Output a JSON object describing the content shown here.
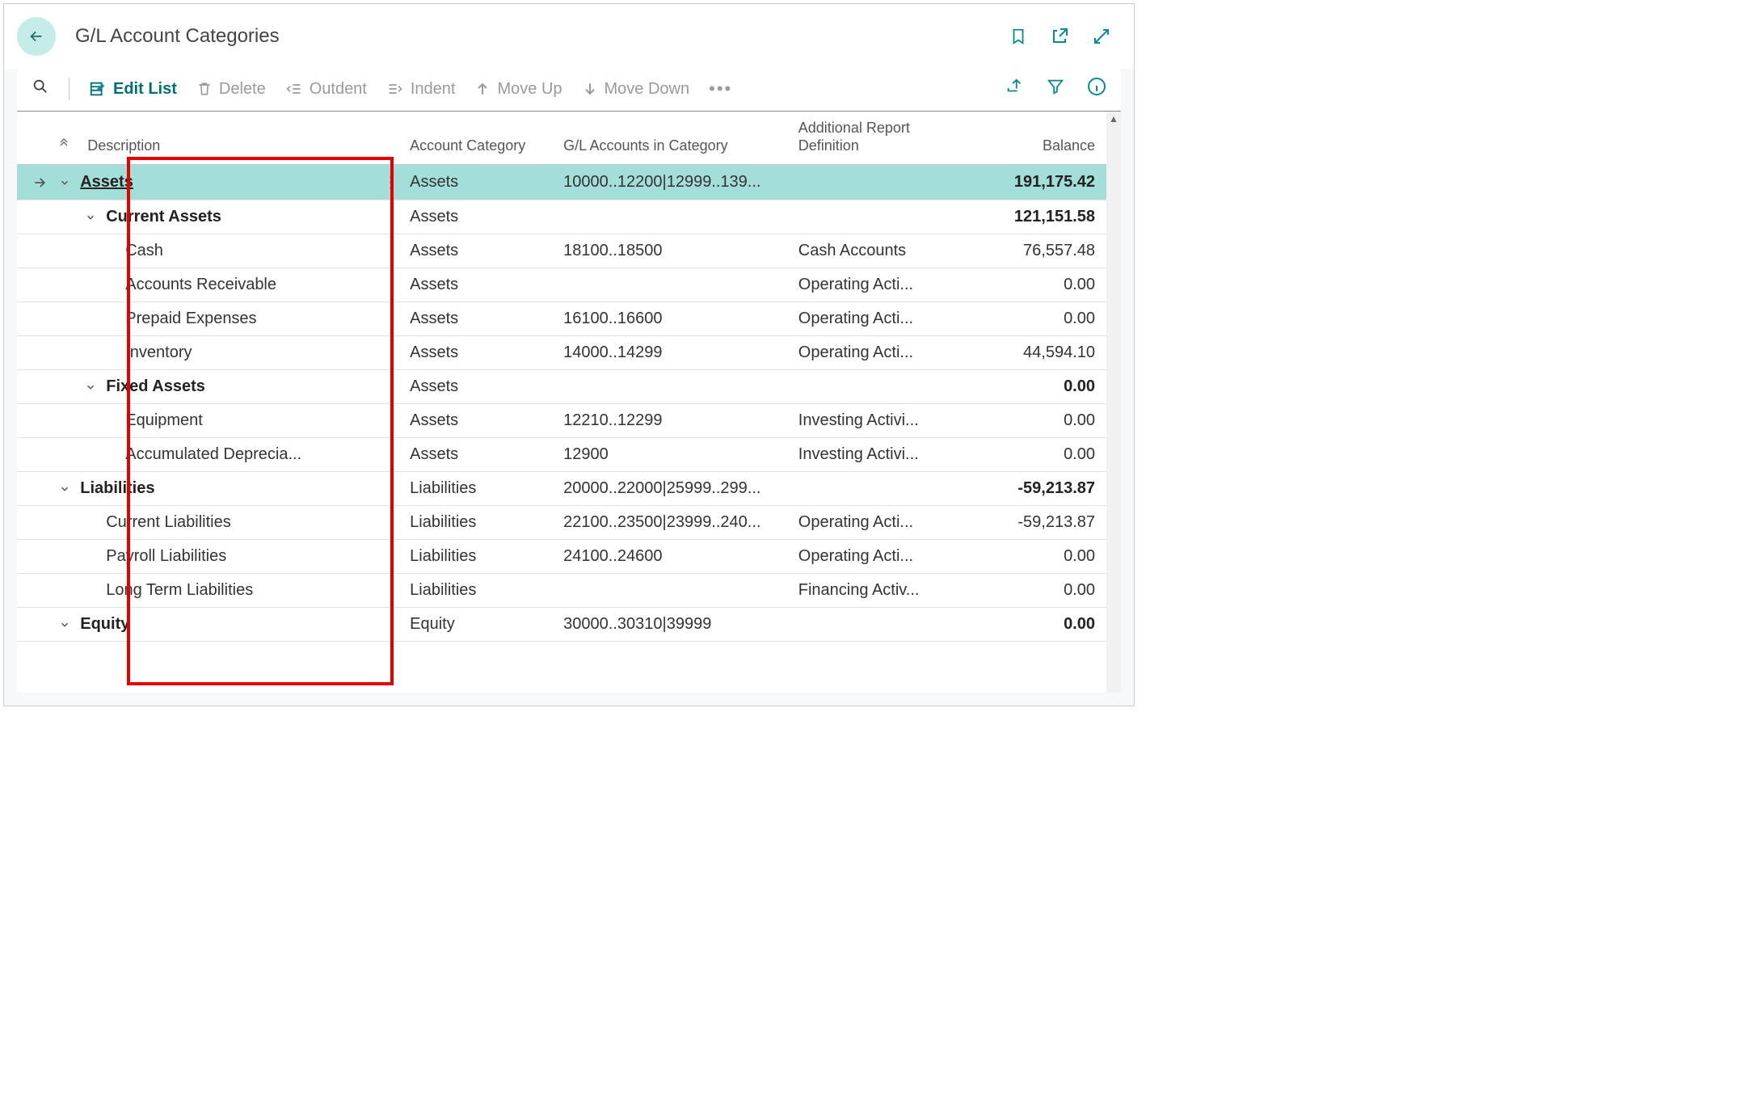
{
  "page_title": "G/L Account Categories",
  "toolbar": {
    "edit_list": "Edit List",
    "delete": "Delete",
    "outdent": "Outdent",
    "indent": "Indent",
    "move_up": "Move Up",
    "move_down": "Move Down"
  },
  "columns": {
    "description": "Description",
    "account_category": "Account Category",
    "gl_accounts": "G/L Accounts in Category",
    "report_def": "Additional Report Definition",
    "balance": "Balance"
  },
  "rows": [
    {
      "indent": 0,
      "bold": true,
      "expand": true,
      "selected": true,
      "underline": true,
      "description": "Assets",
      "account_category": "Assets",
      "gl_accounts": "10000..12200|12999..139...",
      "report_def": "",
      "balance": "191,175.42",
      "show_row_arrow": true,
      "show_more": true
    },
    {
      "indent": 1,
      "bold": true,
      "expand": true,
      "description": "Current Assets",
      "account_category": "Assets",
      "gl_accounts": "",
      "report_def": "",
      "balance": "121,151.58"
    },
    {
      "indent": 2,
      "description": "Cash",
      "account_category": "Assets",
      "gl_accounts": "18100..18500",
      "report_def": "Cash Accounts",
      "balance": "76,557.48"
    },
    {
      "indent": 2,
      "description": "Accounts Receivable",
      "account_category": "Assets",
      "gl_accounts": "",
      "report_def": "Operating Acti...",
      "balance": "0.00"
    },
    {
      "indent": 2,
      "description": "Prepaid Expenses",
      "account_category": "Assets",
      "gl_accounts": "16100..16600",
      "report_def": "Operating Acti...",
      "balance": "0.00"
    },
    {
      "indent": 2,
      "description": "Inventory",
      "account_category": "Assets",
      "gl_accounts": "14000..14299",
      "report_def": "Operating Acti...",
      "balance": "44,594.10"
    },
    {
      "indent": 1,
      "bold": true,
      "expand": true,
      "description": "Fixed Assets",
      "account_category": "Assets",
      "gl_accounts": "",
      "report_def": "",
      "balance": "0.00"
    },
    {
      "indent": 2,
      "description": "Equipment",
      "account_category": "Assets",
      "gl_accounts": "12210..12299",
      "report_def": "Investing Activi...",
      "balance": "0.00"
    },
    {
      "indent": 2,
      "description": "Accumulated Deprecia...",
      "account_category": "Assets",
      "gl_accounts": "12900",
      "report_def": "Investing Activi...",
      "balance": "0.00"
    },
    {
      "indent": 0,
      "bold": true,
      "expand": true,
      "description": "Liabilities",
      "account_category": "Liabilities",
      "gl_accounts": "20000..22000|25999..299...",
      "report_def": "",
      "balance": "-59,213.87"
    },
    {
      "indent": 1,
      "description": "Current Liabilities",
      "account_category": "Liabilities",
      "gl_accounts": "22100..23500|23999..240...",
      "report_def": "Operating Acti...",
      "balance": "-59,213.87"
    },
    {
      "indent": 1,
      "description": "Payroll Liabilities",
      "account_category": "Liabilities",
      "gl_accounts": "24100..24600",
      "report_def": "Operating Acti...",
      "balance": "0.00"
    },
    {
      "indent": 1,
      "description": "Long Term Liabilities",
      "account_category": "Liabilities",
      "gl_accounts": "",
      "report_def": "Financing Activ...",
      "balance": "0.00"
    },
    {
      "indent": 0,
      "bold": true,
      "expand": true,
      "description": "Equity",
      "account_category": "Equity",
      "gl_accounts": "30000..30310|39999",
      "report_def": "",
      "balance": "0.00"
    }
  ]
}
